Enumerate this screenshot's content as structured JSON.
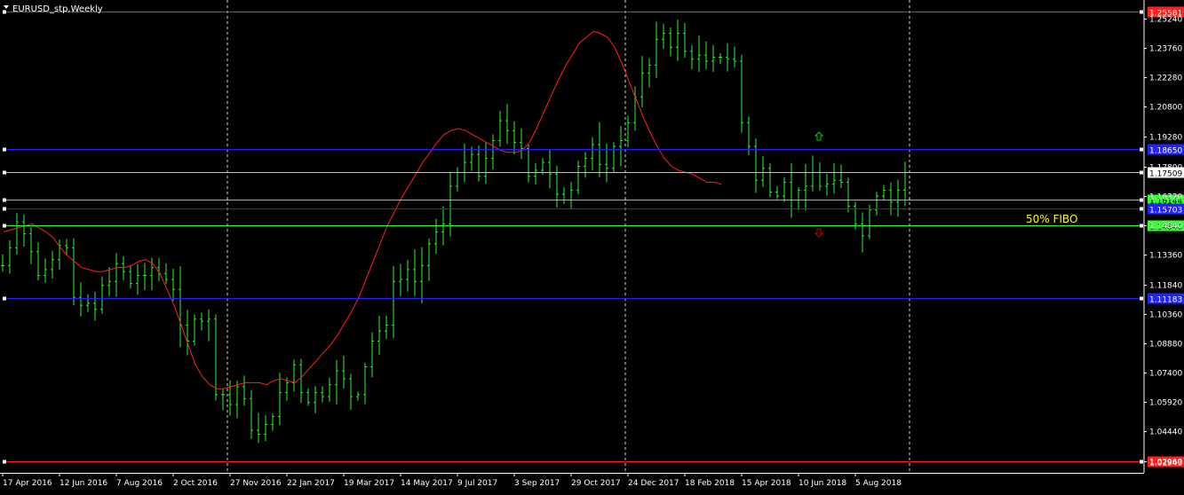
{
  "window": {
    "title": "EURUSD_stp,Weekly"
  },
  "chart_data": {
    "type": "ohlc",
    "symbol": "EURUSD_stp",
    "timeframe": "Weekly",
    "ylim": [
      1.0236,
      1.2618
    ],
    "y_ticks": [
      1.0296,
      1.0444,
      1.0592,
      1.074,
      1.0888,
      1.1036,
      1.1184,
      1.1336,
      1.1484,
      1.1632,
      1.178,
      1.1928,
      1.208,
      1.2228,
      1.2376,
      1.2524
    ],
    "y_tick_labels": [
      "1.02960",
      "1.04440",
      "1.05920",
      "1.07400",
      "1.08880",
      "1.10360",
      "1.11840",
      "1.13360",
      "1.14840",
      "1.16320",
      "1.17800",
      "1.19280",
      "1.20800",
      "1.22280",
      "1.23760",
      "1.25240"
    ],
    "x_tick_labels": [
      "17 Apr 2016",
      "12 Jun 2016",
      "7 Aug 2016",
      "2 Oct 2016",
      "27 Nov 2016",
      "22 Jan 2017",
      "19 Mar 2017",
      "14 May 2017",
      "9 Jul 2017",
      "3 Sep 2017",
      "29 Oct 2017",
      "24 Dec 2017",
      "18 Feb 2018",
      "15 Apr 2018",
      "10 Jun 2018",
      "5 Aug 2018"
    ],
    "x_tick_index": [
      0,
      8,
      16,
      24,
      32,
      40,
      48,
      56,
      64,
      72,
      80,
      88,
      96,
      104,
      112,
      120
    ],
    "bar_count": 128,
    "closes": [
      1.128,
      1.137,
      1.15,
      1.144,
      1.135,
      1.123,
      1.126,
      1.131,
      1.138,
      1.137,
      1.112,
      1.108,
      1.109,
      1.106,
      1.118,
      1.12,
      1.129,
      1.125,
      1.119,
      1.123,
      1.123,
      1.127,
      1.124,
      1.121,
      1.116,
      1.098,
      1.09,
      1.101,
      1.1,
      1.101,
      1.063,
      1.063,
      1.058,
      1.067,
      1.061,
      1.045,
      1.043,
      1.048,
      1.052,
      1.064,
      1.069,
      1.078,
      1.064,
      1.059,
      1.064,
      1.062,
      1.068,
      1.075,
      1.071,
      1.062,
      1.063,
      1.077,
      1.09,
      1.095,
      1.098,
      1.12,
      1.121,
      1.126,
      1.12,
      1.128,
      1.139,
      1.145,
      1.149,
      1.168,
      1.175,
      1.18,
      1.184,
      1.173,
      1.182,
      1.191,
      1.201,
      1.196,
      1.19,
      1.187,
      1.173,
      1.176,
      1.18,
      1.174,
      1.164,
      1.161,
      1.166,
      1.178,
      1.182,
      1.189,
      1.179,
      1.177,
      1.188,
      1.191,
      1.2,
      1.213,
      1.225,
      1.229,
      1.242,
      1.245,
      1.238,
      1.245,
      1.236,
      1.232,
      1.234,
      1.231,
      1.233,
      1.233,
      1.232,
      1.231,
      1.2,
      1.188,
      1.171,
      1.177,
      1.165,
      1.163,
      1.17,
      1.161,
      1.166,
      1.168,
      1.175,
      1.168,
      1.169,
      1.171,
      1.17,
      1.158,
      1.149,
      1.143,
      1.156,
      1.163,
      1.166,
      1.16,
      1.166,
      1.175
    ],
    "moving_average": {
      "color": "#ff2020",
      "values": [
        1.145,
        1.146,
        1.147,
        1.148,
        1.149,
        1.147,
        1.145,
        1.142,
        1.137,
        1.133,
        1.13,
        1.127,
        1.126,
        1.125,
        1.125,
        1.126,
        1.127,
        1.127,
        1.128,
        1.13,
        1.131,
        1.129,
        1.124,
        1.116,
        1.108,
        1.098,
        1.088,
        1.078,
        1.072,
        1.068,
        1.066,
        1.066,
        1.067,
        1.068,
        1.069,
        1.069,
        1.069,
        1.068,
        1.07,
        1.071,
        1.07,
        1.069,
        1.072,
        1.076,
        1.08,
        1.084,
        1.088,
        1.093,
        1.099,
        1.105,
        1.112,
        1.121,
        1.13,
        1.139,
        1.148,
        1.155,
        1.162,
        1.168,
        1.174,
        1.18,
        1.185,
        1.19,
        1.194,
        1.196,
        1.197,
        1.196,
        1.194,
        1.192,
        1.19,
        1.188,
        1.186,
        1.185,
        1.185,
        1.186,
        1.19,
        1.197,
        1.205,
        1.213,
        1.221,
        1.228,
        1.234,
        1.24,
        1.243,
        1.246,
        1.245,
        1.243,
        1.238,
        1.23,
        1.221,
        1.212,
        1.203,
        1.195,
        1.188,
        1.182,
        1.178,
        1.176,
        1.175,
        1.174,
        1.172,
        1.17,
        1.17,
        1.169
      ]
    },
    "horizontal_lines": [
      {
        "price": 1.2558,
        "label": "1.25581",
        "color": "#ff2020",
        "label_bg": "#ff2020",
        "label_fg": "#ffffff"
      },
      {
        "price": 1.1865,
        "label": "1.18650",
        "color": "#2222ff",
        "label_bg": "#2222ff",
        "label_fg": "#ffffff"
      },
      {
        "price": 1.1751,
        "label": "1.17509",
        "color": "#c0c0c0",
        "label_bg": "#ffffff",
        "label_fg": "#000000"
      },
      {
        "price": 1.1614,
        "label": "1.16144",
        "color": "#33ff33",
        "label_bg": "#33ff33",
        "label_fg": "#000000"
      },
      {
        "price": 1.157,
        "label": "1.15703",
        "color": "#2222ff",
        "label_bg": "#2222ff",
        "label_fg": "#ffffff"
      },
      {
        "price": 1.1484,
        "label": "1.14840",
        "color": "#33ff33",
        "label_bg": "#33ff33",
        "label_fg": "#000000"
      },
      {
        "price": 1.1118,
        "label": "1.11183",
        "color": "#2222ff",
        "label_bg": "#2222ff",
        "label_fg": "#ffffff"
      },
      {
        "price": 1.0294,
        "label": "1.02943",
        "color": "#ff2020",
        "label_bg": "#ff2020",
        "label_fg": "#ffffff"
      }
    ],
    "annotations": [
      {
        "text": "50% FIBO",
        "color": "#ffff00",
        "price": 1.1484
      }
    ],
    "arrows": [
      {
        "direction": "up",
        "color": "#00cc00",
        "price": 1.1928
      },
      {
        "direction": "down",
        "color": "#cc0000",
        "price": 1.1448
      }
    ],
    "vertical_separators_at_index": [
      32,
      88,
      128
    ],
    "colors": {
      "background": "#000000",
      "bars": "#33ee33",
      "grid": "#ffffff",
      "axis_text": "#ffffff"
    }
  }
}
